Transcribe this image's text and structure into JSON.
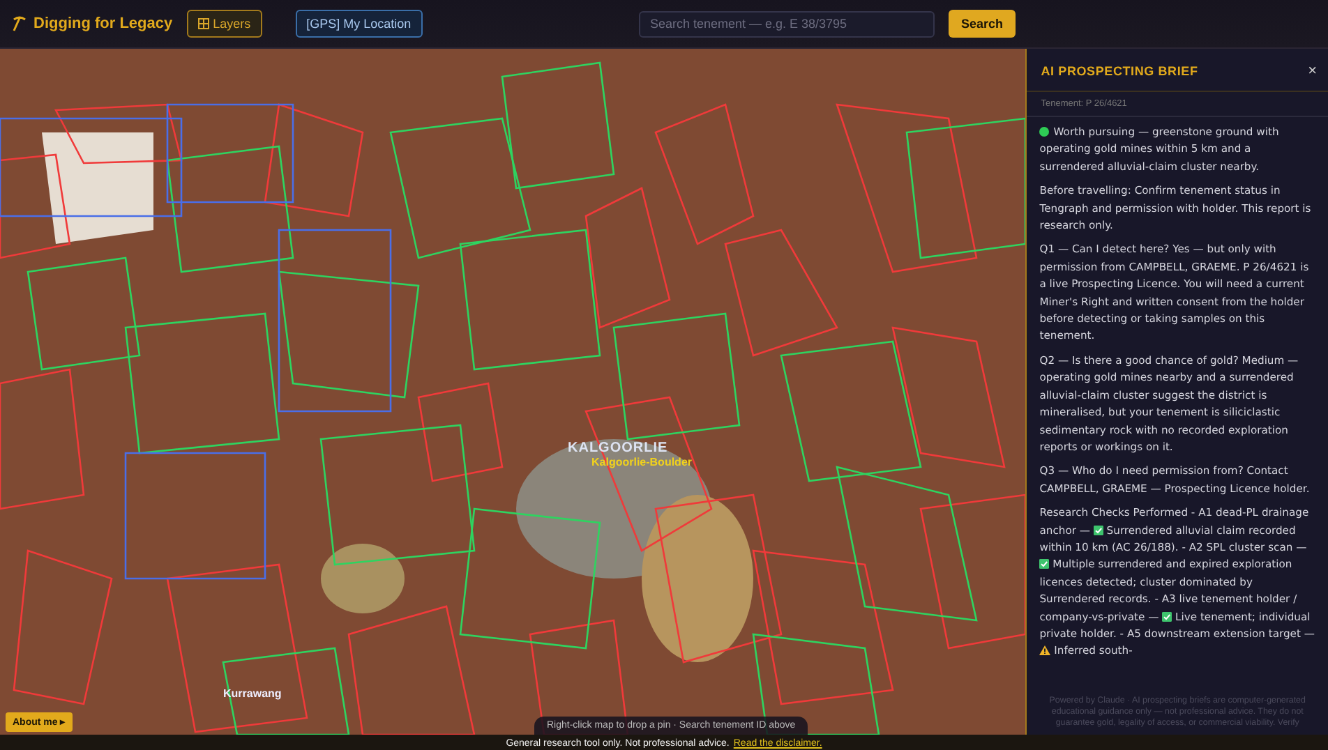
{
  "header": {
    "title": "Digging for Legacy",
    "buttons": [
      {
        "label": "Layers",
        "kind": "layers"
      },
      {
        "label": "[GPS] My Location",
        "kind": "location"
      }
    ],
    "search": {
      "placeholder": "Search tenement — e.g. E 38/3795",
      "button": "Search"
    }
  },
  "map": {
    "labels": [
      {
        "text": "KALGOORLIE",
        "kind": "town"
      },
      {
        "text": "Kalgoorlie-Boulder",
        "kind": "locality"
      },
      {
        "text": "Kurrawang",
        "kind": "place"
      }
    ],
    "about_button": "About me ▸",
    "hint": "Right-click map to drop a pin · Search tenement ID above"
  },
  "brief": {
    "title": "AI PROSPECTING BRIEF",
    "close": "×",
    "tenement": "Tenement: P 26/4621",
    "verdict": {
      "color": "#2ecc55",
      "text": "Worth pursuing — greenstone ground with operating gold mines within 5 km and a surrendered alluvial-claim cluster nearby."
    },
    "paragraphs": [
      "Before travelling: Confirm tenement status in Tengraph and permission with holder. This report is research only.",
      "Q1 — Can I detect here? Yes — but only with permission from CAMPBELL, GRAEME. P 26/4621 is a live Prospecting Licence. You will need a current Miner's Right and written consent from the holder before detecting or taking samples on this tenement.",
      "Q2 — Is there a good chance of gold? Medium — operating gold mines nearby and a surrendered alluvial-claim cluster suggest the district is mineralised, but your tenement is siliciclastic sedimentary rock with no recorded exploration reports or workings on it.",
      "Q3 — Who do I need permission from? Contact CAMPBELL, GRAEME — Prospecting Licence holder."
    ],
    "checks": [
      {
        "kind": "text",
        "text": "Research Checks Performed - A1 dead-PL drainage anchor — "
      },
      {
        "kind": "pass"
      },
      {
        "kind": "text",
        "text": " Surrendered alluvial claim recorded within 10 km (AC 26/188). - A2 SPL cluster scan — "
      },
      {
        "kind": "pass"
      },
      {
        "kind": "text",
        "text": " Multiple surrendered and expired exploration licences detected; cluster dominated by Surrendered records. - A3 live tenement holder / company-vs-private — "
      },
      {
        "kind": "pass"
      },
      {
        "kind": "text",
        "text": " Live tenement; individual private holder. - A5 downstream extension target — "
      },
      {
        "kind": "warn"
      },
      {
        "kind": "text",
        "text": " Inferred south-"
      }
    ],
    "footer": "Powered by Claude · AI prospecting briefs are computer-generated educational guidance only — not professional advice. They do not guarantee gold, legality of access, or commercial viability. Verify"
  },
  "status_bar": {
    "text": "General research tool only. Not professional advice.",
    "link": "Read the disclaimer."
  }
}
